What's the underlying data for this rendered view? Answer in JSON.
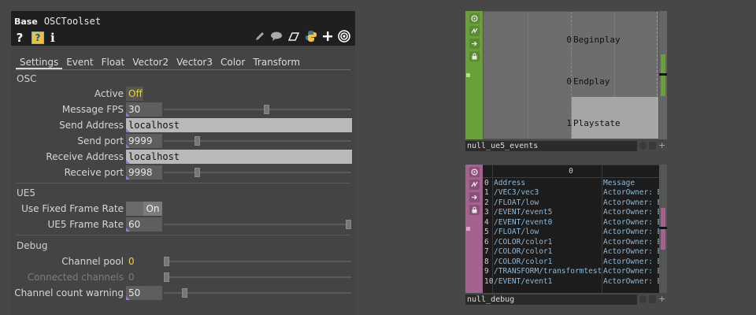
{
  "params": {
    "op_type": "Base",
    "op_name": "OSCToolset",
    "help": {
      "question": "?",
      "doc": "?",
      "info": "i"
    },
    "tool_icons": [
      "pencil-icon",
      "comment-icon",
      "clone-icon",
      "python-icon",
      "add-icon",
      "target-icon"
    ],
    "tabs": [
      "Settings",
      "Event",
      "Float",
      "Vector2",
      "Vector3",
      "Color",
      "Transform"
    ],
    "osc": {
      "title": "OSC",
      "active_label": "Active",
      "active_value": "Off",
      "fps_label": "Message FPS",
      "fps_value": "30",
      "fps_slider": 0.55,
      "send_address_label": "Send Address",
      "send_address_value": "localhost",
      "send_port_label": "Send port",
      "send_port_value": "9999",
      "send_port_slider": 0.17,
      "receive_address_label": "Receive Address",
      "receive_address_value": "localhost",
      "receive_port_label": "Receive port",
      "receive_port_value": "9998",
      "receive_port_slider": 0.17
    },
    "ue5": {
      "title": "UE5",
      "fixed_rate_label": "Use Fixed Frame Rate",
      "fixed_rate_value": "On",
      "frame_rate_label": "UE5 Frame Rate",
      "frame_rate_value": "60",
      "frame_rate_slider": 1.0
    },
    "debug": {
      "title": "Debug",
      "channel_pool_label": "Channel pool",
      "channel_pool_value": "0",
      "channel_pool_slider": 0.0,
      "connected_label": "Connected channels",
      "connected_value": "0",
      "connected_slider": 0.0,
      "count_warning_label": "Channel count warning",
      "count_warning_value": "50",
      "count_warning_slider": 0.1
    }
  },
  "events_dat": {
    "name": "null_ue5_events",
    "rows": [
      {
        "value": "0",
        "name": "Beginplay"
      },
      {
        "value": "0",
        "name": "Endplay"
      },
      {
        "value": "1",
        "name": "Playstate"
      }
    ]
  },
  "debug_dat": {
    "name": "null_debug",
    "col_header": "0",
    "headers": {
      "index": "0",
      "address": "Address",
      "message": "Message"
    },
    "rows": [
      {
        "index": "1",
        "address": "/VEC3/vec3",
        "message": "ActorOwner: B"
      },
      {
        "index": "2",
        "address": "/FLOAT/low",
        "message": "ActorOwner: B"
      },
      {
        "index": "3",
        "address": "/EVENT/event5",
        "message": "ActorOwner: B"
      },
      {
        "index": "4",
        "address": "/EVENT/event0",
        "message": "ActorOwner: B"
      },
      {
        "index": "5",
        "address": "/FLOAT/low",
        "message": "ActorOwner: B"
      },
      {
        "index": "6",
        "address": "/COLOR/color1",
        "message": "ActorOwner: B"
      },
      {
        "index": "7",
        "address": "/COLOR/color1",
        "message": "ActorOwner: B"
      },
      {
        "index": "8",
        "address": "/COLOR/color1",
        "message": "ActorOwner: B"
      },
      {
        "index": "9",
        "address": "/TRANSFORM/transformtest",
        "message": "ActorOwner: B"
      },
      {
        "index": "10",
        "address": "/EVENT/event1",
        "message": "ActorOwner: B"
      }
    ]
  },
  "colors": {
    "events_accent": "#6aa03a",
    "debug_accent": "#a3638e",
    "yellow_value": "#e6d44a"
  }
}
